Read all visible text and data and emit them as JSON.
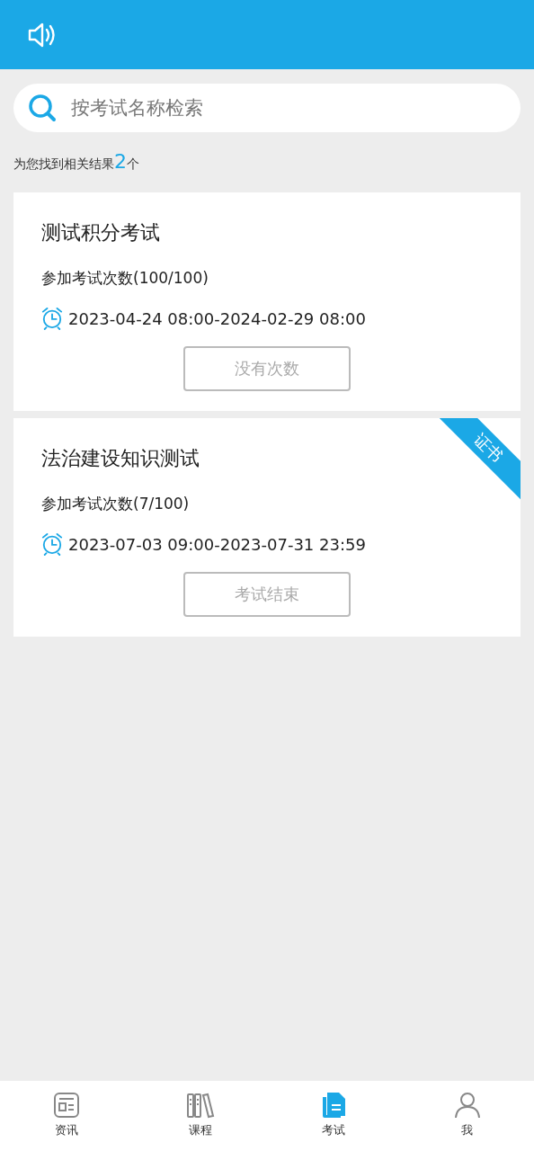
{
  "search": {
    "placeholder": "按考试名称检索"
  },
  "result": {
    "prefix": "为您找到相关结果",
    "count": "2",
    "suffix": "个"
  },
  "exams": [
    {
      "title": "测试积分考试",
      "attempts": "参加考试次数(100/100)",
      "period": "2023-04-24 08:00-2024-02-29 08:00",
      "button": {
        "label": "没有次数",
        "disabled": true
      }
    },
    {
      "title": "法治建设知识测试",
      "attempts": "参加考试次数(7/100)",
      "period": "2023-07-03 09:00-2023-07-31 23:59",
      "badge": "证书",
      "button": {
        "label": "考试结束",
        "disabled": true
      }
    }
  ],
  "tabs": [
    {
      "label": "资讯",
      "kind": "news",
      "selected": false
    },
    {
      "label": "课程",
      "kind": "books",
      "selected": false
    },
    {
      "label": "考试",
      "kind": "exam",
      "selected": true
    },
    {
      "label": "我",
      "kind": "user",
      "selected": false
    }
  ]
}
